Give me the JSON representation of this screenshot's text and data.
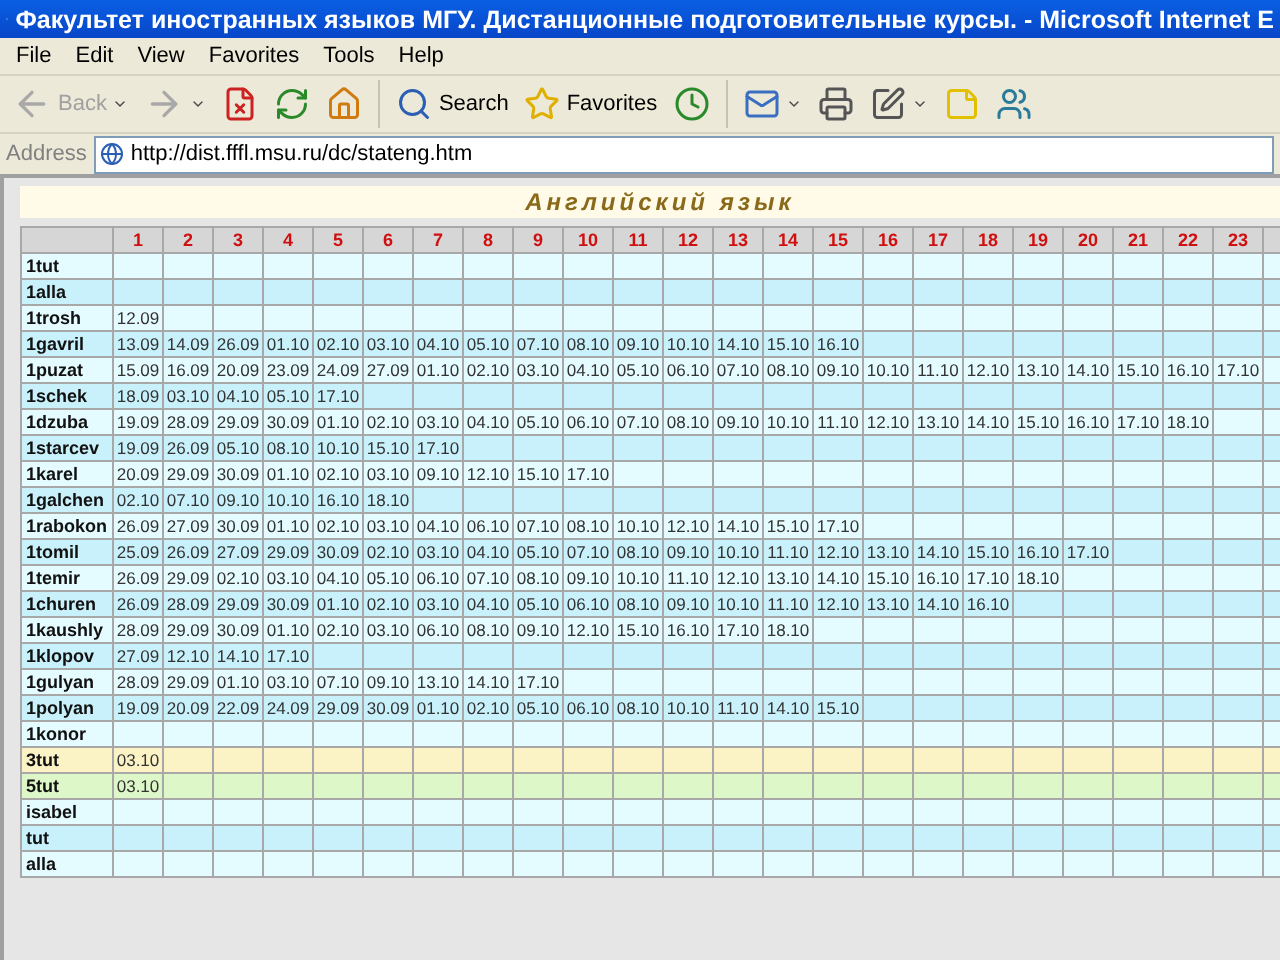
{
  "window": {
    "title": "Факультет иностранных языков МГУ. Дистанционные подготовительные курсы. - Microsoft Internet E"
  },
  "menu": [
    "File",
    "Edit",
    "View",
    "Favorites",
    "Tools",
    "Help"
  ],
  "toolbar": [
    {
      "kind": "back",
      "label": "Back",
      "disabled": true
    },
    {
      "kind": "forward",
      "disabled": true
    },
    {
      "kind": "stop"
    },
    {
      "kind": "refresh"
    },
    {
      "kind": "home"
    },
    {
      "kind": "sep"
    },
    {
      "kind": "search",
      "label": "Search"
    },
    {
      "kind": "favorites",
      "label": "Favorites"
    },
    {
      "kind": "history"
    },
    {
      "kind": "sep"
    },
    {
      "kind": "mail"
    },
    {
      "kind": "print"
    },
    {
      "kind": "edit"
    },
    {
      "kind": "notes"
    },
    {
      "kind": "messenger"
    }
  ],
  "address": {
    "label": "Address",
    "value": "http://dist.fffl.msu.ru/dc/stateng.htm"
  },
  "page": {
    "heading": "Английский язык"
  },
  "table": {
    "columns": [
      "1",
      "2",
      "3",
      "4",
      "5",
      "6",
      "7",
      "8",
      "9",
      "10",
      "11",
      "12",
      "13",
      "14",
      "15",
      "16",
      "17",
      "18",
      "19",
      "20",
      "21",
      "22",
      "23"
    ],
    "rows": [
      {
        "name": "1tut",
        "color": "#e4fbff",
        "dates": []
      },
      {
        "name": "1alla",
        "color": "#c9f1fb",
        "dates": []
      },
      {
        "name": "1trosh",
        "color": "#e4fbff",
        "dates": [
          "12.09"
        ]
      },
      {
        "name": "1gavril",
        "color": "#c9f1fb",
        "dates": [
          "13.09",
          "14.09",
          "26.09",
          "01.10",
          "02.10",
          "03.10",
          "04.10",
          "05.10",
          "07.10",
          "08.10",
          "09.10",
          "10.10",
          "14.10",
          "15.10",
          "16.10"
        ]
      },
      {
        "name": "1puzat",
        "color": "#e4fbff",
        "dates": [
          "15.09",
          "16.09",
          "20.09",
          "23.09",
          "24.09",
          "27.09",
          "01.10",
          "02.10",
          "03.10",
          "04.10",
          "05.10",
          "06.10",
          "07.10",
          "08.10",
          "09.10",
          "10.10",
          "11.10",
          "12.10",
          "13.10",
          "14.10",
          "15.10",
          "16.10",
          "17.10"
        ]
      },
      {
        "name": "1schek",
        "color": "#c9f1fb",
        "dates": [
          "18.09",
          "03.10",
          "04.10",
          "05.10",
          "17.10"
        ]
      },
      {
        "name": "1dzuba",
        "color": "#e4fbff",
        "dates": [
          "19.09",
          "28.09",
          "29.09",
          "30.09",
          "01.10",
          "02.10",
          "03.10",
          "04.10",
          "05.10",
          "06.10",
          "07.10",
          "08.10",
          "09.10",
          "10.10",
          "11.10",
          "12.10",
          "13.10",
          "14.10",
          "15.10",
          "16.10",
          "17.10",
          "18.10"
        ]
      },
      {
        "name": "1starcev",
        "color": "#c9f1fb",
        "dates": [
          "19.09",
          "26.09",
          "05.10",
          "08.10",
          "10.10",
          "15.10",
          "17.10"
        ]
      },
      {
        "name": "1karel",
        "color": "#e4fbff",
        "dates": [
          "20.09",
          "29.09",
          "30.09",
          "01.10",
          "02.10",
          "03.10",
          "09.10",
          "12.10",
          "15.10",
          "17.10"
        ]
      },
      {
        "name": "1galchen",
        "color": "#c9f1fb",
        "dates": [
          "02.10",
          "07.10",
          "09.10",
          "10.10",
          "16.10",
          "18.10"
        ]
      },
      {
        "name": "1rabokon",
        "color": "#e4fbff",
        "dates": [
          "26.09",
          "27.09",
          "30.09",
          "01.10",
          "02.10",
          "03.10",
          "04.10",
          "06.10",
          "07.10",
          "08.10",
          "10.10",
          "12.10",
          "14.10",
          "15.10",
          "17.10"
        ]
      },
      {
        "name": "1tomil",
        "color": "#c9f1fb",
        "dates": [
          "25.09",
          "26.09",
          "27.09",
          "29.09",
          "30.09",
          "02.10",
          "03.10",
          "04.10",
          "05.10",
          "07.10",
          "08.10",
          "09.10",
          "10.10",
          "11.10",
          "12.10",
          "13.10",
          "14.10",
          "15.10",
          "16.10",
          "17.10"
        ]
      },
      {
        "name": "1temir",
        "color": "#e4fbff",
        "dates": [
          "26.09",
          "29.09",
          "02.10",
          "03.10",
          "04.10",
          "05.10",
          "06.10",
          "07.10",
          "08.10",
          "09.10",
          "10.10",
          "11.10",
          "12.10",
          "13.10",
          "14.10",
          "15.10",
          "16.10",
          "17.10",
          "18.10"
        ]
      },
      {
        "name": "1churen",
        "color": "#c9f1fb",
        "dates": [
          "26.09",
          "28.09",
          "29.09",
          "30.09",
          "01.10",
          "02.10",
          "03.10",
          "04.10",
          "05.10",
          "06.10",
          "08.10",
          "09.10",
          "10.10",
          "11.10",
          "12.10",
          "13.10",
          "14.10",
          "16.10"
        ]
      },
      {
        "name": "1kaushly",
        "color": "#e4fbff",
        "dates": [
          "28.09",
          "29.09",
          "30.09",
          "01.10",
          "02.10",
          "03.10",
          "06.10",
          "08.10",
          "09.10",
          "12.10",
          "15.10",
          "16.10",
          "17.10",
          "18.10"
        ]
      },
      {
        "name": "1klopov",
        "color": "#c9f1fb",
        "dates": [
          "27.09",
          "12.10",
          "14.10",
          "17.10"
        ]
      },
      {
        "name": "1gulyan",
        "color": "#e4fbff",
        "dates": [
          "28.09",
          "29.09",
          "01.10",
          "03.10",
          "07.10",
          "09.10",
          "13.10",
          "14.10",
          "17.10"
        ]
      },
      {
        "name": "1polyan",
        "color": "#c9f1fb",
        "dates": [
          "19.09",
          "20.09",
          "22.09",
          "24.09",
          "29.09",
          "30.09",
          "01.10",
          "02.10",
          "05.10",
          "06.10",
          "08.10",
          "10.10",
          "11.10",
          "14.10",
          "15.10"
        ]
      },
      {
        "name": "1konor",
        "color": "#e4fbff",
        "dates": []
      },
      {
        "name": "3tut",
        "color": "#fbf3c6",
        "dates": [
          "03.10"
        ]
      },
      {
        "name": "5tut",
        "color": "#ddf7c9",
        "dates": [
          "03.10"
        ]
      },
      {
        "name": "isabel",
        "color": "#e4fbff",
        "dates": []
      },
      {
        "name": "tut",
        "color": "#c9f1fb",
        "dates": []
      },
      {
        "name": "alla",
        "color": "#e4fbff",
        "dates": []
      }
    ]
  }
}
